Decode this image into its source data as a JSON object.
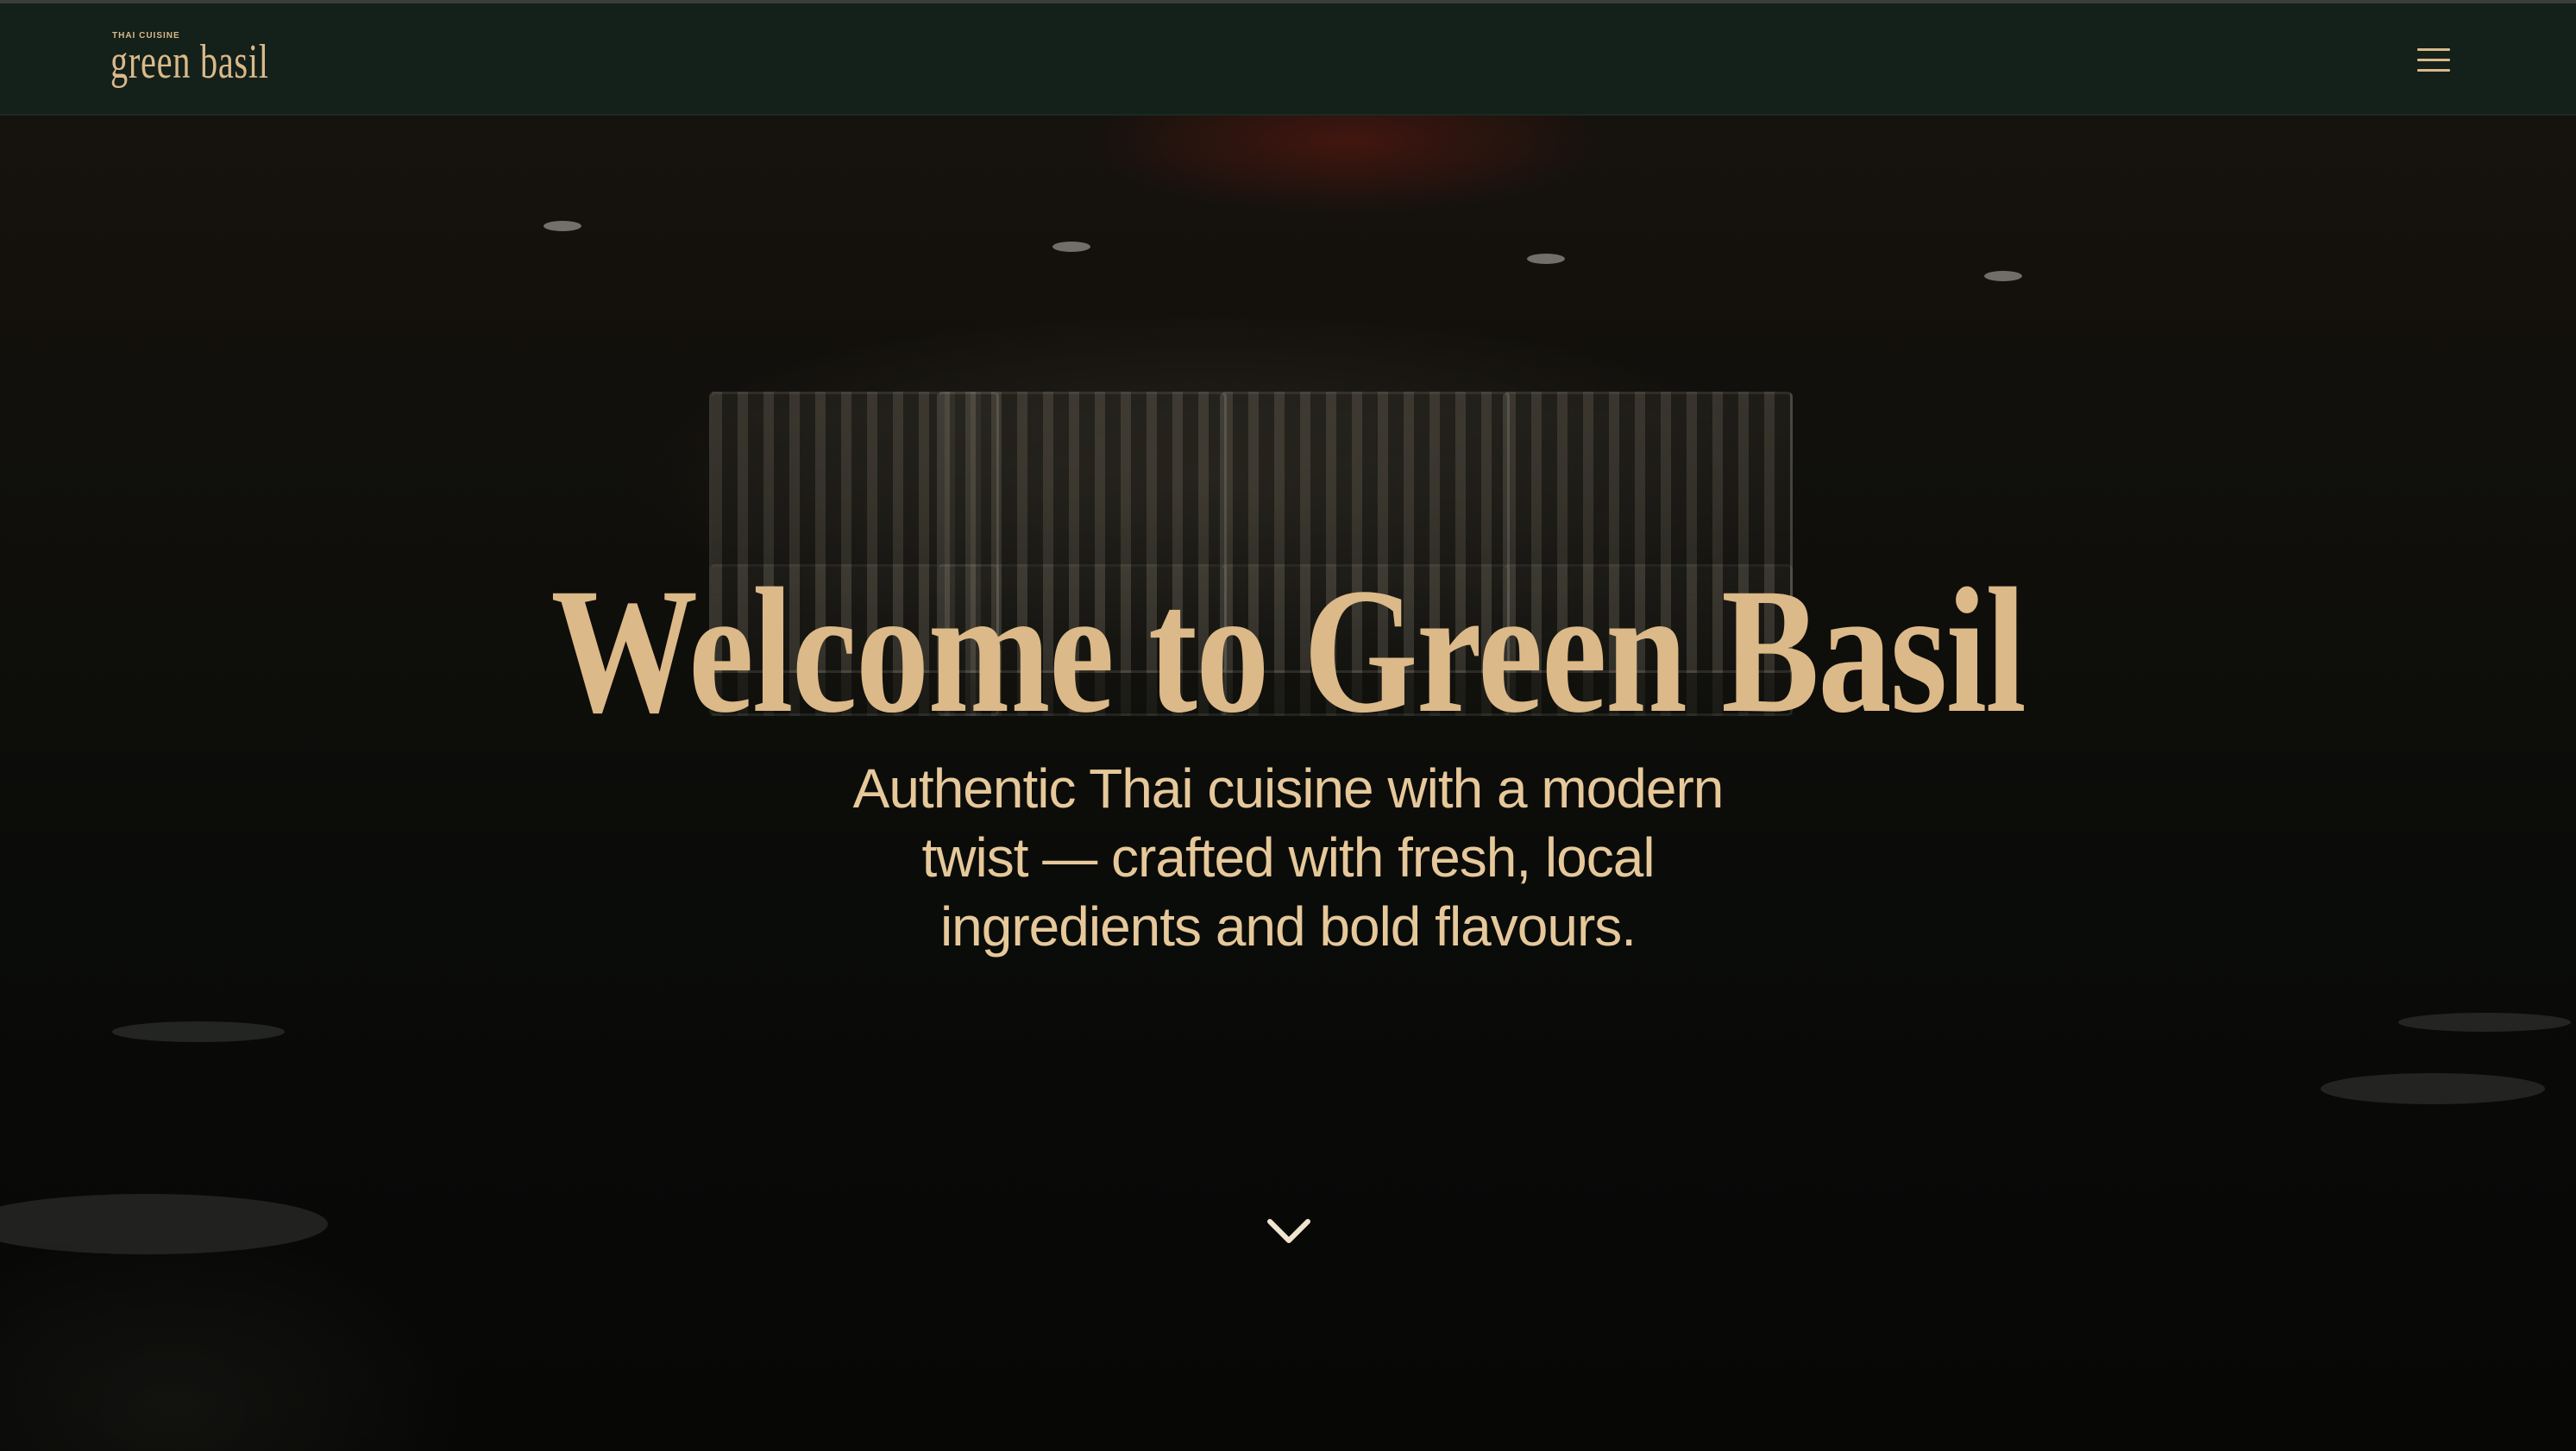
{
  "header": {
    "logo_small": "THAI CUISINE",
    "logo_main": "green basil",
    "menu_icon": "hamburger-menu-icon"
  },
  "hero": {
    "title": "Welcome to Green Basil",
    "subtitle": "Authentic Thai cuisine with a modern twist — crafted with fresh, local ingredients and bold flavours.",
    "scroll_icon": "chevron-down-icon"
  },
  "colors": {
    "accent_gold": "#dcb988",
    "navbar_bg": "#14201a"
  }
}
